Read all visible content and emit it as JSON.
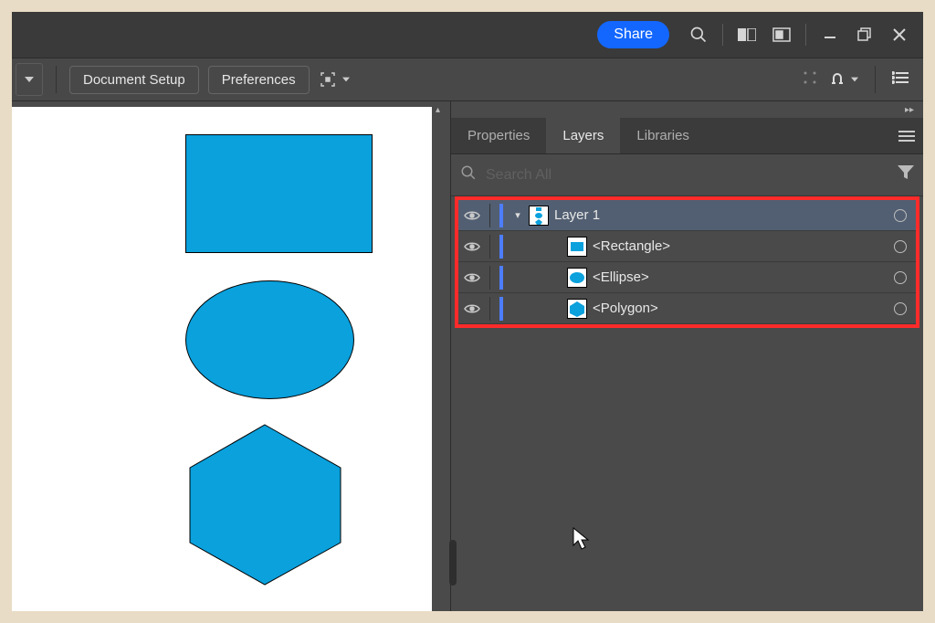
{
  "titlebar": {
    "share_label": "Share"
  },
  "toolbar": {
    "doc_setup": "Document Setup",
    "preferences": "Preferences"
  },
  "panel": {
    "tabs": {
      "properties": "Properties",
      "layers": "Layers",
      "libraries": "Libraries"
    },
    "search_placeholder": "Search All"
  },
  "layers": {
    "root": {
      "name": "Layer 1"
    },
    "items": [
      {
        "name": "<Rectangle>"
      },
      {
        "name": "<Ellipse>"
      },
      {
        "name": "<Polygon>"
      }
    ]
  }
}
